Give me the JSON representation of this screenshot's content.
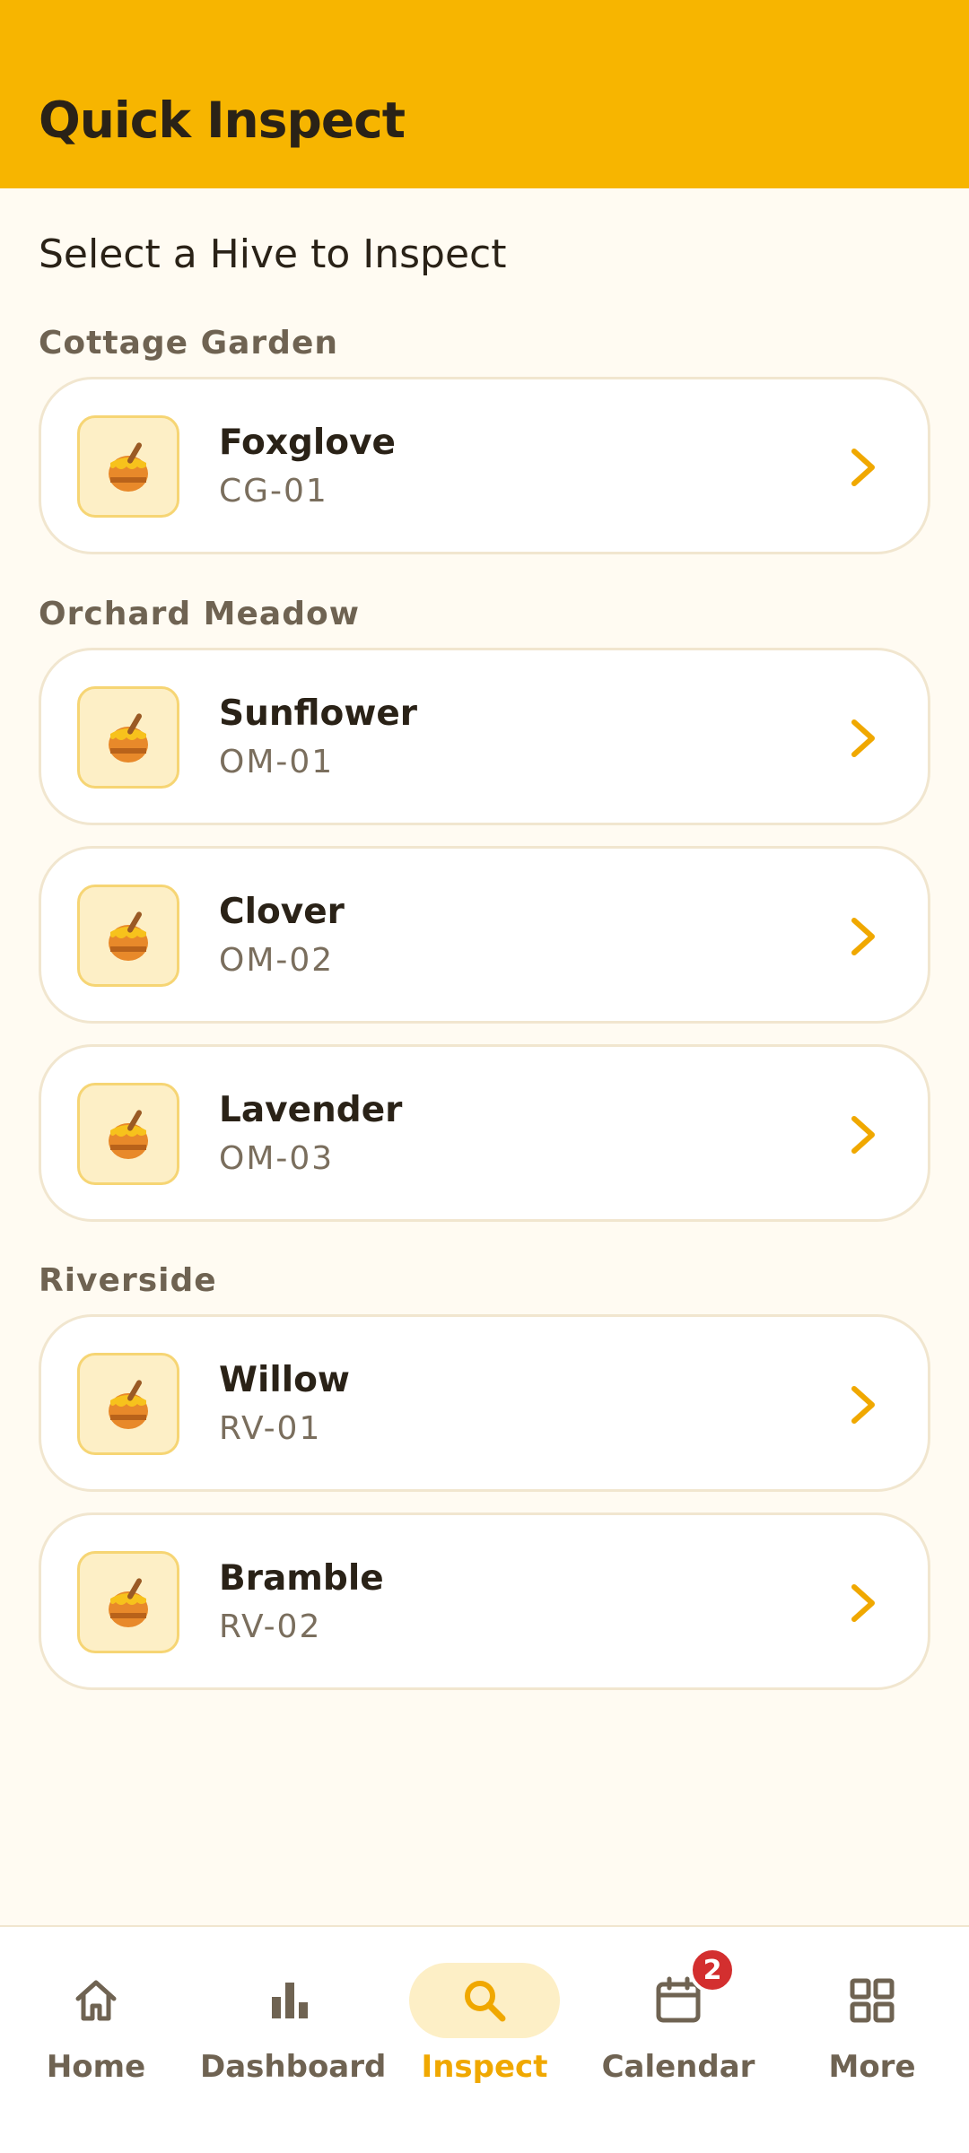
{
  "header": {
    "title": "Quick Inspect"
  },
  "main": {
    "heading": "Select a Hive to Inspect",
    "groups": [
      {
        "label": "Cottage Garden",
        "hives": [
          {
            "name": "Foxglove",
            "code": "CG-01"
          }
        ]
      },
      {
        "label": "Orchard Meadow",
        "hives": [
          {
            "name": "Sunflower",
            "code": "OM-01"
          },
          {
            "name": "Clover",
            "code": "OM-02"
          },
          {
            "name": "Lavender",
            "code": "OM-03"
          }
        ]
      },
      {
        "label": "Riverside",
        "hives": [
          {
            "name": "Willow",
            "code": "RV-01"
          },
          {
            "name": "Bramble",
            "code": "RV-02"
          }
        ]
      }
    ]
  },
  "nav": {
    "items": [
      {
        "label": "Home",
        "icon": "home-icon"
      },
      {
        "label": "Dashboard",
        "icon": "bar-chart-icon"
      },
      {
        "label": "Inspect",
        "icon": "search-icon",
        "active": true
      },
      {
        "label": "Calendar",
        "icon": "calendar-icon",
        "badge": "2"
      },
      {
        "label": "More",
        "icon": "grid-icon"
      }
    ]
  },
  "colors": {
    "accent": "#f7b500",
    "background": "#fffbf2",
    "badge": "#d32f2f"
  }
}
